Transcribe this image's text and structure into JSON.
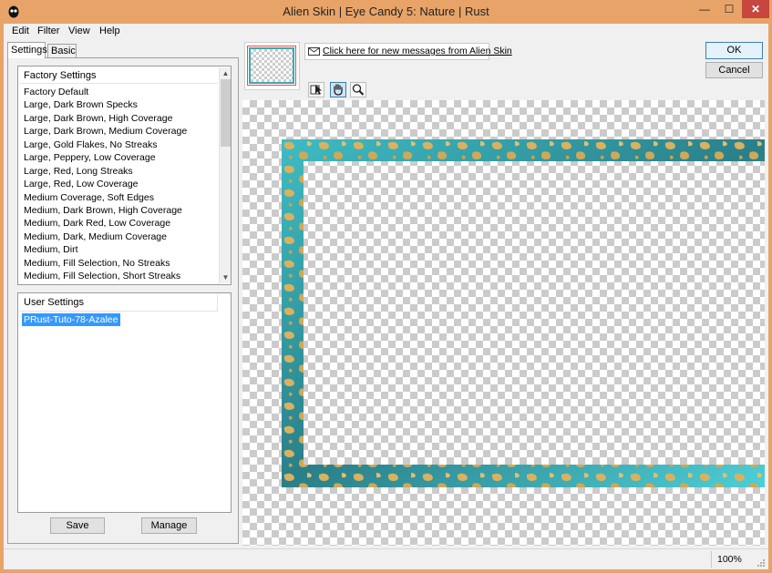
{
  "window": {
    "title": "Alien Skin | Eye Candy 5: Nature | Rust",
    "min_glyph": "—",
    "max_glyph": "☐",
    "close_glyph": "✕"
  },
  "menu": [
    "Edit",
    "Filter",
    "View",
    "Help"
  ],
  "tabs": {
    "settings": "Settings",
    "basic": "Basic"
  },
  "factory": {
    "header": "Factory Settings",
    "items": [
      "Factory Default",
      "Large, Dark Brown Specks",
      "Large, Dark Brown, High Coverage",
      "Large, Dark Brown, Medium Coverage",
      "Large, Gold Flakes, No Streaks",
      "Large, Peppery, Low Coverage",
      "Large, Red, Long Streaks",
      "Large, Red, Low Coverage",
      "Medium Coverage, Soft Edges",
      "Medium, Dark Brown, High Coverage",
      "Medium, Dark Red, Low Coverage",
      "Medium, Dark, Medium Coverage",
      "Medium, Dirt",
      "Medium, Fill Selection, No Streaks",
      "Medium, Fill Selection, Short Streaks"
    ]
  },
  "user": {
    "header": "User Settings",
    "selected_item": "PRust-Tuto-78-Azalee"
  },
  "buttons": {
    "save": "Save",
    "manage": "Manage",
    "ok": "OK",
    "cancel": "Cancel"
  },
  "message_link": "Click here for new messages from Alien Skin",
  "tools": [
    "arrow-icon",
    "hand-icon",
    "zoom-icon"
  ],
  "status": {
    "zoom": "100%"
  },
  "colors": {
    "titlebar": "#e8a468",
    "close": "#c7463d",
    "selection": "#3399ff",
    "frame_teal": "#2f8a93",
    "frame_gold": "#d9b15a"
  }
}
